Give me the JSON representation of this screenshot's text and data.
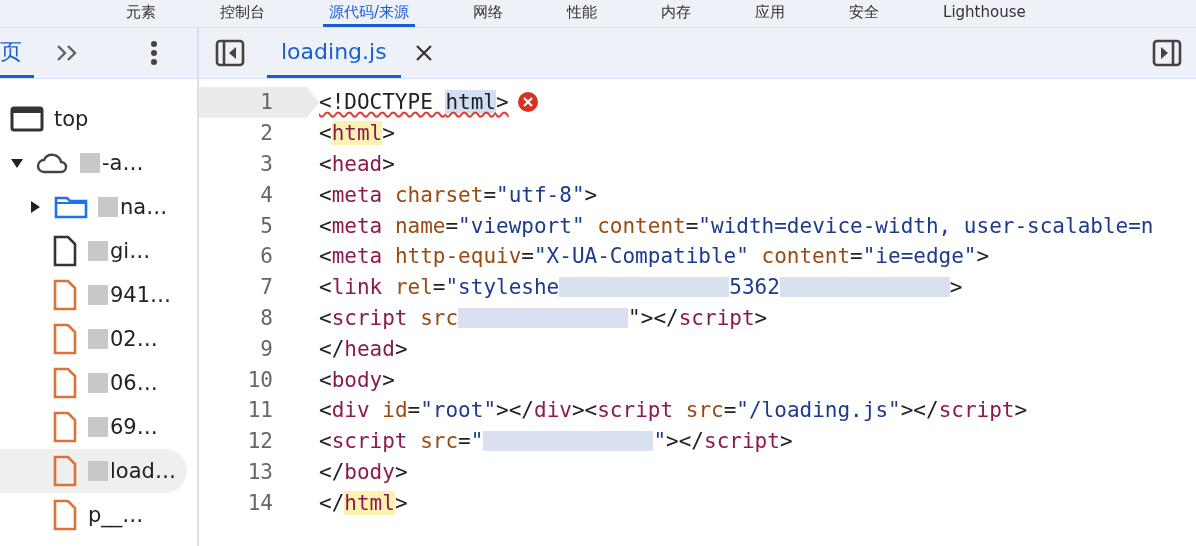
{
  "top_tabs": [
    {
      "label": "元素",
      "selected": false
    },
    {
      "label": "控制台",
      "selected": false
    },
    {
      "label": "源代码/来源",
      "selected": true
    },
    {
      "label": "网络",
      "selected": false
    },
    {
      "label": "性能",
      "selected": false
    },
    {
      "label": "内存",
      "selected": false
    },
    {
      "label": "应用",
      "selected": false
    },
    {
      "label": "安全",
      "selected": false
    },
    {
      "label": "Lighthouse",
      "selected": false
    }
  ],
  "navigator": {
    "tab": {
      "label": "页",
      "selected": true
    },
    "tree": [
      {
        "label": "top",
        "kind": "frame",
        "selected": false
      },
      {
        "label": "-a…",
        "kind": "cloud",
        "expanded": true,
        "blurred": true,
        "selected": false,
        "children": [
          {
            "label": "na…",
            "kind": "folder",
            "expanded": false,
            "blurred": true,
            "selected": false
          },
          {
            "label": "gi…",
            "kind": "file",
            "blurred": true,
            "selected": false
          },
          {
            "label": "941…",
            "kind": "script",
            "blurred": true,
            "selected": false
          },
          {
            "label": "02…",
            "kind": "script",
            "blurred": true,
            "selected": false
          },
          {
            "label": "06…",
            "kind": "script",
            "blurred": true,
            "selected": false
          },
          {
            "label": "69…",
            "kind": "script",
            "blurred": true,
            "selected": false
          },
          {
            "label": "load…",
            "kind": "script",
            "blurred": true,
            "selected": true
          },
          {
            "label": "p__…",
            "kind": "script",
            "blurred": false,
            "selected": false
          }
        ]
      }
    ]
  },
  "editor": {
    "tab": {
      "label": "loading.js",
      "selected": true
    },
    "lines": [
      {
        "number": "1",
        "current": true,
        "error": true,
        "squiggle": true,
        "tokens": [
          {
            "text": "<!DOCTYPE ",
            "kind": "plain"
          },
          {
            "text": "html",
            "kind": "selection"
          },
          {
            "text": ">",
            "kind": "plain"
          }
        ]
      },
      {
        "number": "2",
        "current": false,
        "tokens": [
          {
            "text": "<",
            "kind": "plain"
          },
          {
            "text": "html",
            "kind": "match"
          },
          {
            "text": ">",
            "kind": "plain"
          }
        ]
      },
      {
        "number": "3",
        "current": false,
        "tokens": [
          {
            "text": "<",
            "kind": "plain"
          },
          {
            "text": "head",
            "kind": "tag"
          },
          {
            "text": ">",
            "kind": "plain"
          }
        ]
      },
      {
        "number": "4",
        "current": false,
        "tokens": [
          {
            "text": "<",
            "kind": "plain"
          },
          {
            "text": "meta ",
            "kind": "tag"
          },
          {
            "text": "charset",
            "kind": "attr"
          },
          {
            "text": "=",
            "kind": "plain"
          },
          {
            "text": "\"utf-8\"",
            "kind": "value"
          },
          {
            "text": ">",
            "kind": "plain"
          }
        ]
      },
      {
        "number": "5",
        "current": false,
        "tokens": [
          {
            "text": "<",
            "kind": "plain"
          },
          {
            "text": "meta ",
            "kind": "tag"
          },
          {
            "text": "name",
            "kind": "attr"
          },
          {
            "text": "=",
            "kind": "plain"
          },
          {
            "text": "\"viewport\" ",
            "kind": "value"
          },
          {
            "text": "content",
            "kind": "attr"
          },
          {
            "text": "=",
            "kind": "plain"
          },
          {
            "text": "\"width=device-width, user-scalable=n",
            "kind": "value"
          }
        ]
      },
      {
        "number": "6",
        "current": false,
        "tokens": [
          {
            "text": "<",
            "kind": "plain"
          },
          {
            "text": "meta ",
            "kind": "tag"
          },
          {
            "text": "http-equiv",
            "kind": "attr"
          },
          {
            "text": "=",
            "kind": "plain"
          },
          {
            "text": "\"X-UA-Compatible\" ",
            "kind": "value"
          },
          {
            "text": "content",
            "kind": "attr"
          },
          {
            "text": "=",
            "kind": "plain"
          },
          {
            "text": "\"ie=edge\"",
            "kind": "value"
          },
          {
            "text": ">",
            "kind": "plain"
          }
        ]
      },
      {
        "number": "7",
        "current": false,
        "tokens": [
          {
            "text": "<",
            "kind": "plain"
          },
          {
            "text": "link ",
            "kind": "tag"
          },
          {
            "text": "rel",
            "kind": "attr"
          },
          {
            "text": "=",
            "kind": "plain"
          },
          {
            "text": "\"styleshe",
            "kind": "value"
          },
          {
            "kind": "blur"
          },
          {
            "text": "5362",
            "kind": "value"
          },
          {
            "kind": "blur"
          },
          {
            "text": ">",
            "kind": "plain"
          }
        ]
      },
      {
        "number": "8",
        "current": false,
        "tokens": [
          {
            "text": "<",
            "kind": "plain"
          },
          {
            "text": "script ",
            "kind": "tag"
          },
          {
            "text": "src",
            "kind": "attr"
          },
          {
            "kind": "blur"
          },
          {
            "text": "\">",
            "kind": "plain"
          },
          {
            "text": "</",
            "kind": "plain"
          },
          {
            "text": "script",
            "kind": "tag"
          },
          {
            "text": ">",
            "kind": "plain"
          }
        ]
      },
      {
        "number": "9",
        "current": false,
        "tokens": [
          {
            "text": "</",
            "kind": "plain"
          },
          {
            "text": "head",
            "kind": "tag"
          },
          {
            "text": ">",
            "kind": "plain"
          }
        ]
      },
      {
        "number": "10",
        "current": false,
        "tokens": [
          {
            "text": "<",
            "kind": "plain"
          },
          {
            "text": "body",
            "kind": "tag"
          },
          {
            "text": ">",
            "kind": "plain"
          }
        ]
      },
      {
        "number": "11",
        "current": false,
        "tokens": [
          {
            "text": "<",
            "kind": "plain"
          },
          {
            "text": "div ",
            "kind": "tag"
          },
          {
            "text": "id",
            "kind": "attr"
          },
          {
            "text": "=",
            "kind": "plain"
          },
          {
            "text": "\"root\"",
            "kind": "value"
          },
          {
            "text": "></",
            "kind": "plain"
          },
          {
            "text": "div",
            "kind": "tag"
          },
          {
            "text": "><",
            "kind": "plain"
          },
          {
            "text": "script ",
            "kind": "tag"
          },
          {
            "text": "src",
            "kind": "attr"
          },
          {
            "text": "=",
            "kind": "plain"
          },
          {
            "text": "\"/loading.js\"",
            "kind": "value"
          },
          {
            "text": "></",
            "kind": "plain"
          },
          {
            "text": "script",
            "kind": "tag"
          },
          {
            "text": ">",
            "kind": "plain"
          }
        ]
      },
      {
        "number": "12",
        "current": false,
        "tokens": [
          {
            "text": "<",
            "kind": "plain"
          },
          {
            "text": "script ",
            "kind": "tag"
          },
          {
            "text": "src",
            "kind": "attr"
          },
          {
            "text": "=",
            "kind": "plain"
          },
          {
            "text": "\"",
            "kind": "value"
          },
          {
            "kind": "blur"
          },
          {
            "text": "\"",
            "kind": "value"
          },
          {
            "text": "></",
            "kind": "plain"
          },
          {
            "text": "script",
            "kind": "tag"
          },
          {
            "text": ">",
            "kind": "plain"
          }
        ]
      },
      {
        "number": "13",
        "current": false,
        "tokens": [
          {
            "text": "</",
            "kind": "plain"
          },
          {
            "text": "body",
            "kind": "tag"
          },
          {
            "text": ">",
            "kind": "plain"
          }
        ]
      },
      {
        "number": "14",
        "current": false,
        "tokens": [
          {
            "text": "</",
            "kind": "plain"
          },
          {
            "text": "html",
            "kind": "match"
          },
          {
            "text": ">",
            "kind": "plain"
          }
        ]
      }
    ]
  }
}
